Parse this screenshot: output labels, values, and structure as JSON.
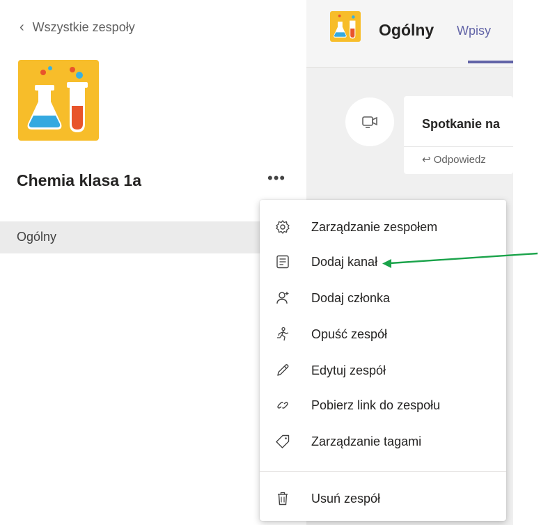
{
  "nav": {
    "back_label": "Wszystkie zespoły"
  },
  "team": {
    "name": "Chemia klasa 1a",
    "more_label": "•••"
  },
  "channels": [
    {
      "label": "Ogólny"
    }
  ],
  "channel_header": {
    "title": "Ogólny",
    "tab_label": "Wpisy"
  },
  "post": {
    "title": "Spotkanie na",
    "reply_label": "Odpowiedz"
  },
  "menu": {
    "items": [
      {
        "label": "Zarządzanie zespołem",
        "icon": "gear-icon"
      },
      {
        "label": "Dodaj kanał",
        "icon": "channel-icon"
      },
      {
        "label": "Dodaj członka",
        "icon": "add-member-icon"
      },
      {
        "label": "Opuść zespół",
        "icon": "leave-icon"
      },
      {
        "label": "Edytuj zespół",
        "icon": "pencil-icon"
      },
      {
        "label": "Pobierz link do zespołu",
        "icon": "link-icon"
      },
      {
        "label": "Zarządzanie tagami",
        "icon": "tag-icon"
      },
      {
        "label": "Usuń zespół",
        "icon": "trash-icon"
      }
    ]
  },
  "colors": {
    "accent": "#6264a7",
    "avatar": "#f7bd2a",
    "annotation": "#1aa34a"
  }
}
